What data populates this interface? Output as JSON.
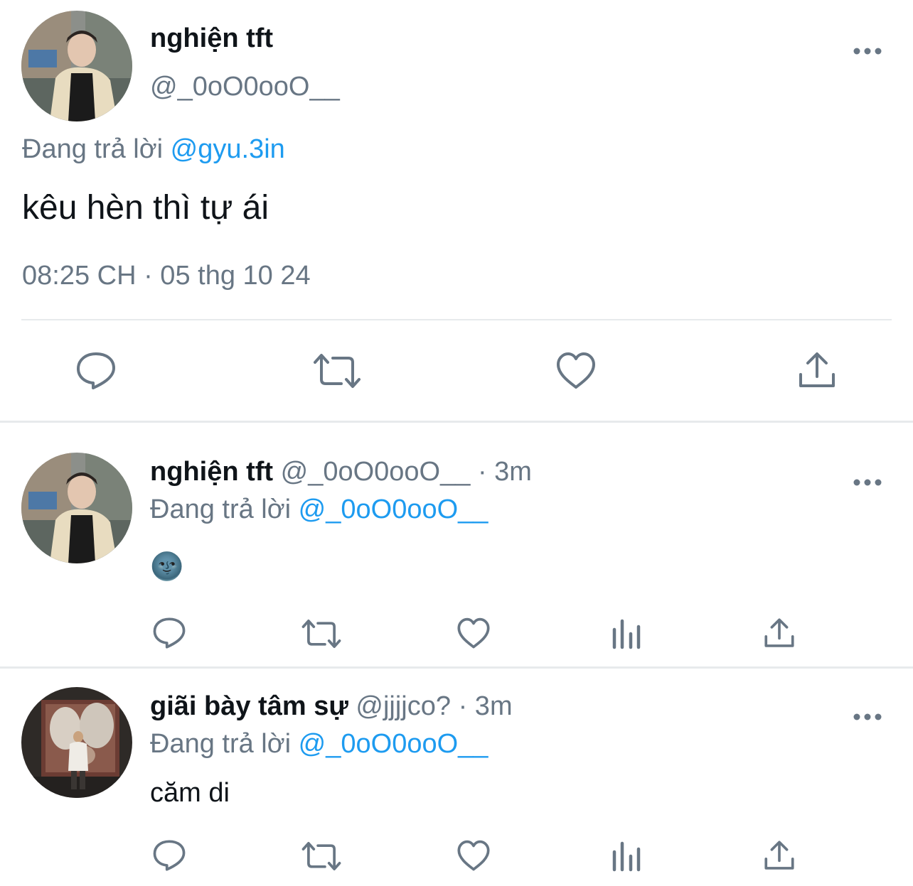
{
  "main_tweet": {
    "display_name": "nghiện tft",
    "handle": "@_0oO0ooO__",
    "replying_label": "Đang trả lời",
    "replying_to": "@gyu.3in",
    "text": "kêu hèn thì tự ái",
    "timestamp": "08:25 CH · 05 thg 10 24",
    "more_icon": "more-icon",
    "actions": [
      "reply-icon",
      "retweet-icon",
      "like-icon",
      "share-icon"
    ]
  },
  "replies": [
    {
      "display_name": "nghiện tft",
      "handle": "@_0oO0ooO__",
      "time": "· 3m",
      "replying_label": "Đang trả lời",
      "replying_to": "@_0oO0ooO__",
      "text": "🌚",
      "actions": [
        "reply-icon",
        "retweet-icon",
        "like-icon",
        "analytics-icon",
        "share-icon"
      ]
    },
    {
      "display_name": "giãi bày tâm sự",
      "handle": "@jjjjco?",
      "time": "· 3m",
      "replying_label": "Đang trả lời",
      "replying_to": "@_0oO0ooO__",
      "text": "căm di",
      "actions": [
        "reply-icon",
        "retweet-icon",
        "like-icon",
        "analytics-icon",
        "share-icon"
      ]
    }
  ],
  "colors": {
    "text": "#0f1419",
    "secondary": "#687684",
    "link": "#1d9bf0",
    "divider": "#e7eaec"
  }
}
